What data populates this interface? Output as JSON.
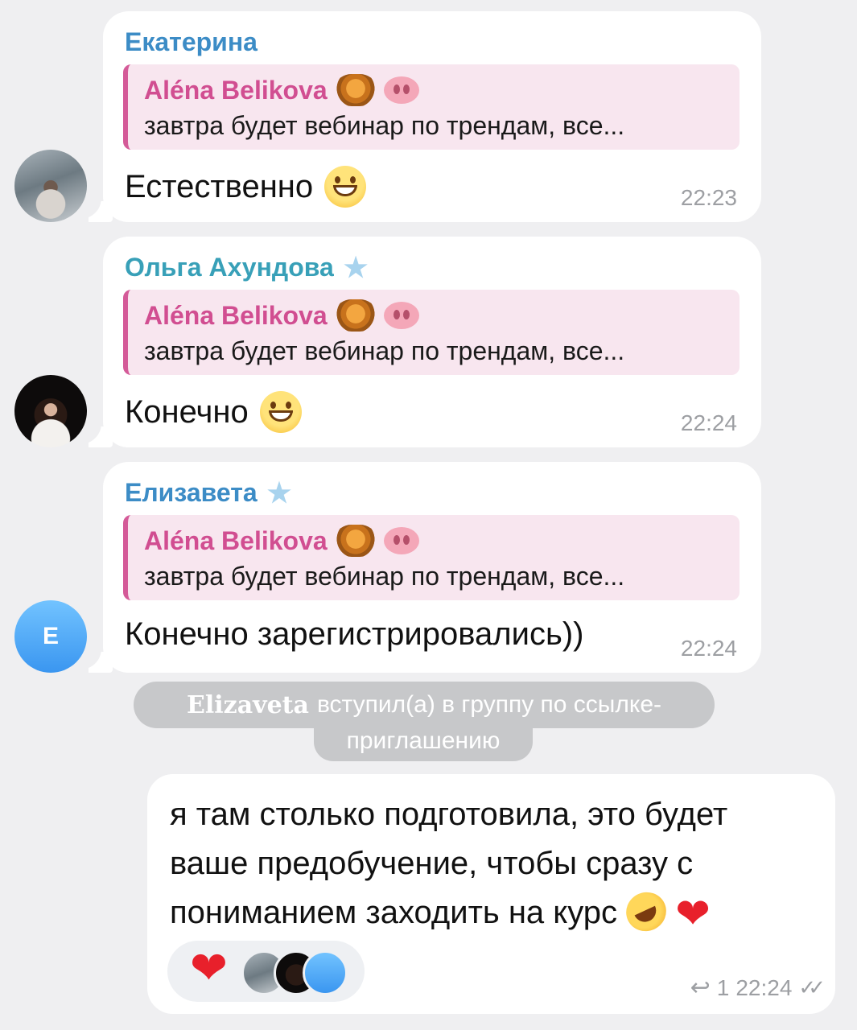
{
  "messages": [
    {
      "sender": "Екатерина",
      "reply_to_name": "Aléna Belikova",
      "reply_to_text": "завтра будет вебинар по трендам, все...",
      "text": "Естественно",
      "time": "22:23",
      "avatar": "photo-winter"
    },
    {
      "sender": "Ольга Ахундова",
      "reply_to_name": "Aléna Belikova",
      "reply_to_text": "завтра будет вебинар по трендам, все...",
      "text": "Конечно",
      "time": "22:24",
      "avatar": "photo-portrait"
    },
    {
      "sender": "Елизавета",
      "reply_to_name": "Aléna Belikova",
      "reply_to_text": "завтра будет вебинар по трендам, все...",
      "text": "Конечно зарегистрировались))",
      "time": "22:24",
      "avatar_letter": "E"
    }
  ],
  "service_message": {
    "name": "Elizaveta",
    "text_line1": "вступил(а) в группу по ссылке-",
    "text_line2": "приглашению"
  },
  "outgoing": {
    "lines": [
      "я там столько подготовила, это будет",
      "ваше предобучение, чтобы сразу с",
      "пониманием заходить на курс"
    ],
    "reply_count": "1",
    "time": "22:24",
    "reaction": "heart"
  }
}
